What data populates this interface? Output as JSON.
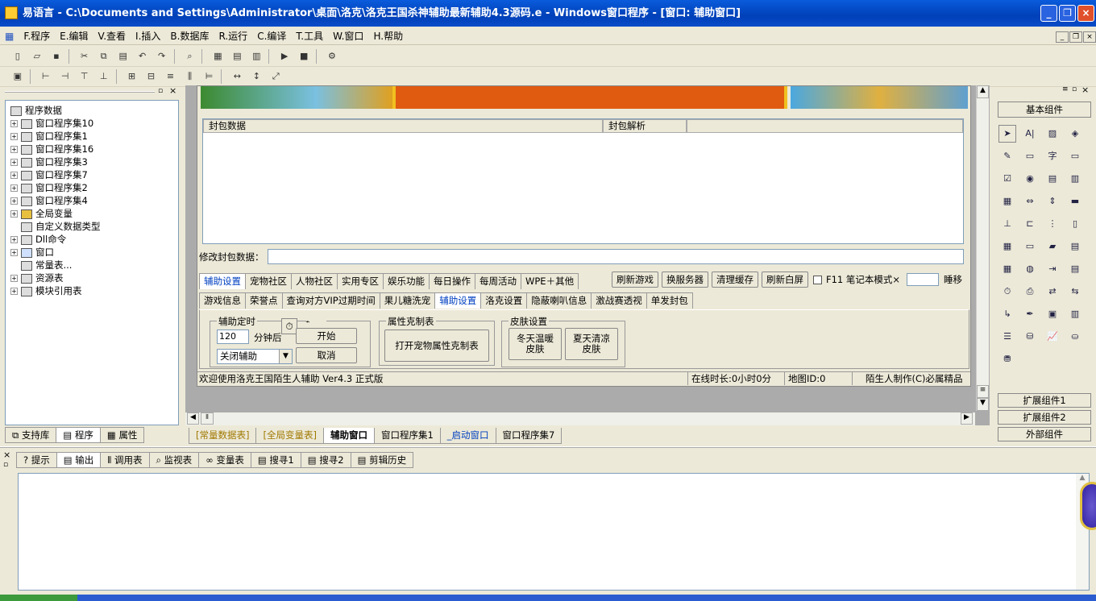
{
  "window": {
    "title": "易语言 - C:\\Documents and Settings\\Administrator\\桌面\\洛克\\洛克王国杀神辅助最新辅助4.3源码.e - Windows窗口程序 - [窗口: 辅助窗口]"
  },
  "menu": [
    "F.程序",
    "E.编辑",
    "V.查看",
    "I.插入",
    "B.数据库",
    "R.运行",
    "C.编译",
    "T.工具",
    "W.窗口",
    "H.帮助"
  ],
  "tree": [
    {
      "label": "程序数据",
      "exp": "",
      "ico": "book"
    },
    {
      "label": "窗口程序集10",
      "exp": "+",
      "ico": "layers"
    },
    {
      "label": "窗口程序集1",
      "exp": "+",
      "ico": "layers"
    },
    {
      "label": "窗口程序集16",
      "exp": "+",
      "ico": "layers"
    },
    {
      "label": "窗口程序集3",
      "exp": "+",
      "ico": "layers"
    },
    {
      "label": "窗口程序集7",
      "exp": "+",
      "ico": "layers"
    },
    {
      "label": "窗口程序集2",
      "exp": "+",
      "ico": "layers"
    },
    {
      "label": "窗口程序集4",
      "exp": "+",
      "ico": "layers"
    },
    {
      "label": "全局变量",
      "exp": "+",
      "ico": "db"
    },
    {
      "label": "自定义数据类型",
      "exp": "",
      "ico": "type"
    },
    {
      "label": "Dll命令",
      "exp": "+",
      "ico": "dll"
    },
    {
      "label": "窗口",
      "exp": "+",
      "ico": "window"
    },
    {
      "label": "常量表...",
      "exp": "",
      "ico": "const"
    },
    {
      "label": "资源表",
      "exp": "+",
      "ico": "res"
    },
    {
      "label": "模块引用表",
      "exp": "+",
      "ico": "mod"
    }
  ],
  "left_tabs": [
    "支持库",
    "程序",
    "属性"
  ],
  "form": {
    "listview_headers": [
      "封包数据",
      "封包解析"
    ],
    "edit_label": "修改封包数据：",
    "tabs_row1": [
      "辅助设置",
      "宠物社区",
      "人物社区",
      "实用专区",
      "娱乐功能",
      "每日操作",
      "每周活动",
      "WPE＋其他"
    ],
    "buttons_row1": [
      "刷新游戏",
      "换服务器",
      "清理缓存",
      "刷新白屏"
    ],
    "checkbox_label": "F11 笔记本模式×",
    "sleep_label": "睡移",
    "tabs_row2": [
      "游戏信息",
      "荣誉点",
      "查询对方VIP过期时间",
      "果儿糖洗宠",
      "辅助设置",
      "洛克设置",
      "隐蔽喇叭信息",
      "激战赛透视",
      "单发封包"
    ],
    "group_timer": {
      "label": "辅助定时",
      "minutes": "120",
      "minutes_suffix": "分钟后",
      "start": "开始",
      "cancel": "取消",
      "select": "关闭辅助"
    },
    "group_pet": {
      "label": "属性克制表",
      "button": "打开宠物属性克制表"
    },
    "group_skin": {
      "label": "皮肤设置",
      "winter": "冬天温暖\n皮肤",
      "summer": "夏天清凉\n皮肤"
    },
    "status": [
      "欢迎使用洛克王国陌生人辅助 Ver4.3 正式版",
      "在线时长:0小时0分",
      "地图ID:0",
      "陌生人制作(C)必属精品"
    ]
  },
  "doc_tabs": [
    "[常量数据表]",
    "[全局变量表]",
    "辅助窗口",
    "窗口程序集1",
    "_启动窗口",
    "窗口程序集7"
  ],
  "right_panel": {
    "basic": "基本组件",
    "ext1": "扩展组件1",
    "ext2": "扩展组件2",
    "ext": "外部组件"
  },
  "bottom_tabs": [
    "提示",
    "输出",
    "调用表",
    "监视表",
    "变量表",
    "搜寻1",
    "搜寻2",
    "剪辑历史"
  ],
  "colors": {
    "title": "#0a4bc8",
    "banner_orange": "#e05a10",
    "banner_blue": "#4aa8e0"
  }
}
